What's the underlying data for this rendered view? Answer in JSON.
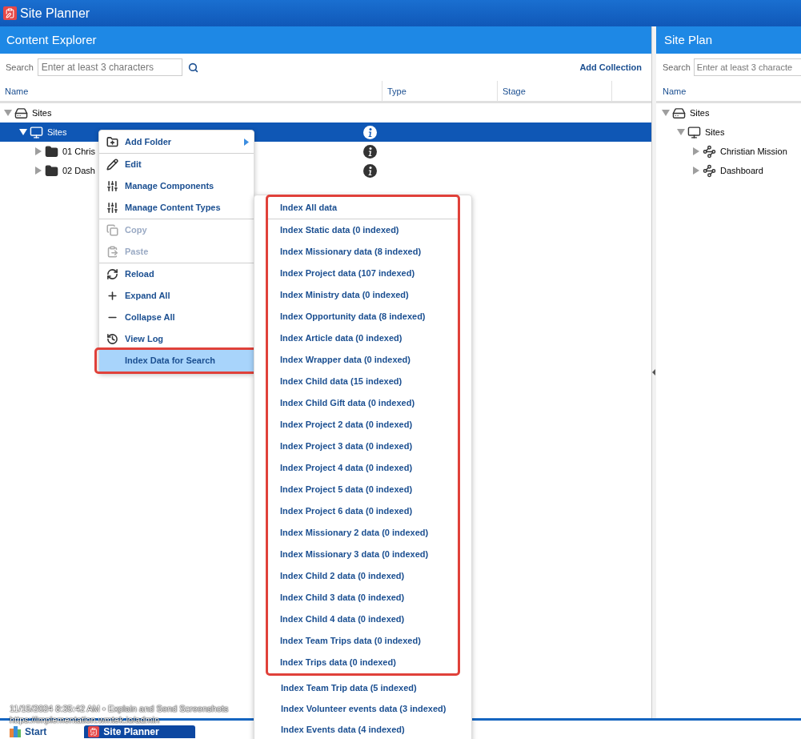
{
  "app": {
    "title": "Site Planner"
  },
  "content_explorer": {
    "title": "Content Explorer",
    "search": {
      "label": "Search",
      "placeholder": "Enter at least 3 characters"
    },
    "add_collection": "Add Collection",
    "columns": [
      "Name",
      "Type",
      "Stage"
    ],
    "tree": [
      {
        "label": "Sites",
        "kind": "root",
        "expanded": true,
        "selected": false,
        "children": [
          {
            "label": "Sites",
            "kind": "site",
            "expanded": true,
            "selected": true,
            "children": [
              {
                "label": "01 Chris",
                "kind": "folder",
                "expanded": false,
                "selected": false
              },
              {
                "label": "02 Dash",
                "kind": "folder",
                "expanded": false,
                "selected": false
              }
            ]
          }
        ]
      }
    ]
  },
  "context_menu": {
    "groups": [
      [
        {
          "label": "Add Folder",
          "submenu": true,
          "disabled": false,
          "highlighted": false,
          "annotated": false
        }
      ],
      [
        {
          "label": "Edit",
          "submenu": false,
          "disabled": false,
          "highlighted": false,
          "annotated": false
        },
        {
          "label": "Manage Components",
          "submenu": false,
          "disabled": false,
          "highlighted": false,
          "annotated": false
        },
        {
          "label": "Manage Content Types",
          "submenu": false,
          "disabled": false,
          "highlighted": false,
          "annotated": false
        }
      ],
      [
        {
          "label": "Copy",
          "submenu": false,
          "disabled": true,
          "highlighted": false,
          "annotated": false
        },
        {
          "label": "Paste",
          "submenu": false,
          "disabled": true,
          "highlighted": false,
          "annotated": false
        }
      ],
      [
        {
          "label": "Reload",
          "submenu": false,
          "disabled": false,
          "highlighted": false,
          "annotated": false
        },
        {
          "label": "Expand All",
          "submenu": false,
          "disabled": false,
          "highlighted": false,
          "annotated": false
        },
        {
          "label": "Collapse All",
          "submenu": false,
          "disabled": false,
          "highlighted": false,
          "annotated": false
        },
        {
          "label": "View Log",
          "submenu": false,
          "disabled": false,
          "highlighted": false,
          "annotated": false
        },
        {
          "label": "Index Data for Search",
          "submenu": false,
          "disabled": false,
          "highlighted": true,
          "annotated": true
        }
      ]
    ]
  },
  "submenu": {
    "frames": [
      {
        "annotated": true,
        "groups": [
          [
            "Index All data"
          ],
          [
            "Index Static data (0 indexed)",
            "Index Missionary data (8 indexed)",
            "Index Project data (107 indexed)",
            "Index Ministry data (0 indexed)",
            "Index Opportunity data (8 indexed)",
            "Index Article data (0 indexed)",
            "Index Wrapper data (0 indexed)",
            "Index Child data (15 indexed)",
            "Index Child Gift data (0 indexed)",
            "Index Project 2 data (0 indexed)",
            "Index Project 3 data (0 indexed)",
            "Index Project 4 data (0 indexed)",
            "Index Project 5 data (0 indexed)",
            "Index Project 6 data (0 indexed)",
            "Index Missionary 2 data (0 indexed)",
            "Index Missionary 3 data (0 indexed)",
            "Index Child 2 data (0 indexed)",
            "Index Child 3 data (0 indexed)",
            "Index Child 4 data (0 indexed)",
            "Index Team Trips data (0 indexed)",
            "Index Trips data (0 indexed)"
          ]
        ]
      },
      {
        "annotated": false,
        "groups": [
          [
            "Index Team Trip data (5 indexed)",
            "Index Volunteer events data (3 indexed)",
            "Index Events data (4 indexed)"
          ]
        ]
      }
    ]
  },
  "site_plan": {
    "title": "Site Plan",
    "search": {
      "label": "Search",
      "placeholder": "Enter at least 3 characte"
    },
    "columns": [
      "Name"
    ],
    "tree": [
      {
        "label": "Sites",
        "kind": "root",
        "expanded": true,
        "selected": false,
        "children": [
          {
            "label": "Sites",
            "kind": "site",
            "expanded": true,
            "selected": false,
            "children": [
              {
                "label": "Christian Mission",
                "kind": "link",
                "expanded": false,
                "selected": false
              },
              {
                "label": "Dashboard",
                "kind": "link",
                "expanded": false,
                "selected": false
              }
            ]
          }
        ]
      }
    ]
  },
  "overlay": {
    "lines": [
      "11/15/2024 8:35:42 AM • Explain and Send Screenshots",
      "https://implementation.wmtek.io/admin"
    ]
  },
  "taskbar": {
    "items": [
      {
        "label": "Start",
        "kind": "start",
        "selected": false
      },
      {
        "label": "Site Planner",
        "kind": "app",
        "selected": true
      }
    ]
  }
}
